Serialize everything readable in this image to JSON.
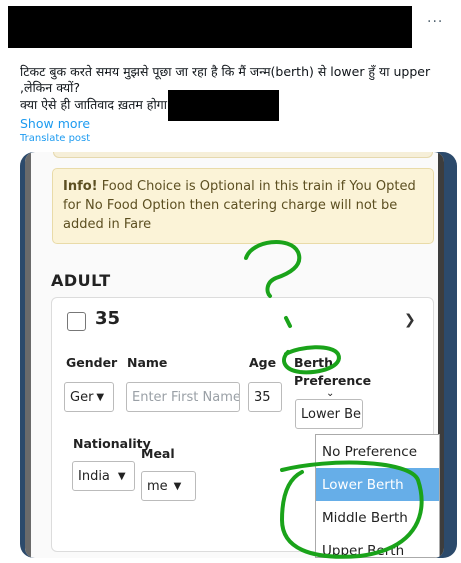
{
  "header": {
    "more_glyph": "···"
  },
  "post": {
    "text_line1": "टिकट बुक करते समय मुझसे पूछा जा रहा है कि मैं जन्म(berth) से lower हुँ या upper ,लेकिन क्यों?",
    "text_line2": "क्या ऐसे ही जातिवाद ख़तम होगा",
    "show_more": "Show more",
    "translate": "Translate post"
  },
  "media": {
    "info": {
      "bold": "Info!",
      "text": " Food Choice is Optional in this train if You Opted for No Food Option then catering charge will not be added in Fare"
    },
    "section_title": "ADULT",
    "passenger": {
      "number": "35",
      "labels": {
        "gender": "Gender",
        "name": "Name",
        "age": "Age",
        "berth": "Berth",
        "preference": "Preference",
        "nationality": "Nationality",
        "meal": "Meal"
      },
      "gender_value": "Ger",
      "name_placeholder": "Enter First Name",
      "age_value": "35",
      "berth_value": "Lower Be",
      "nationality_value": "India",
      "meal_value": "me"
    },
    "berth_options": [
      "No Preference",
      "Lower Berth",
      "Middle Berth",
      "Upper Berth"
    ],
    "selected_berth_index": 1,
    "annotation_color": "#1aa31a"
  }
}
